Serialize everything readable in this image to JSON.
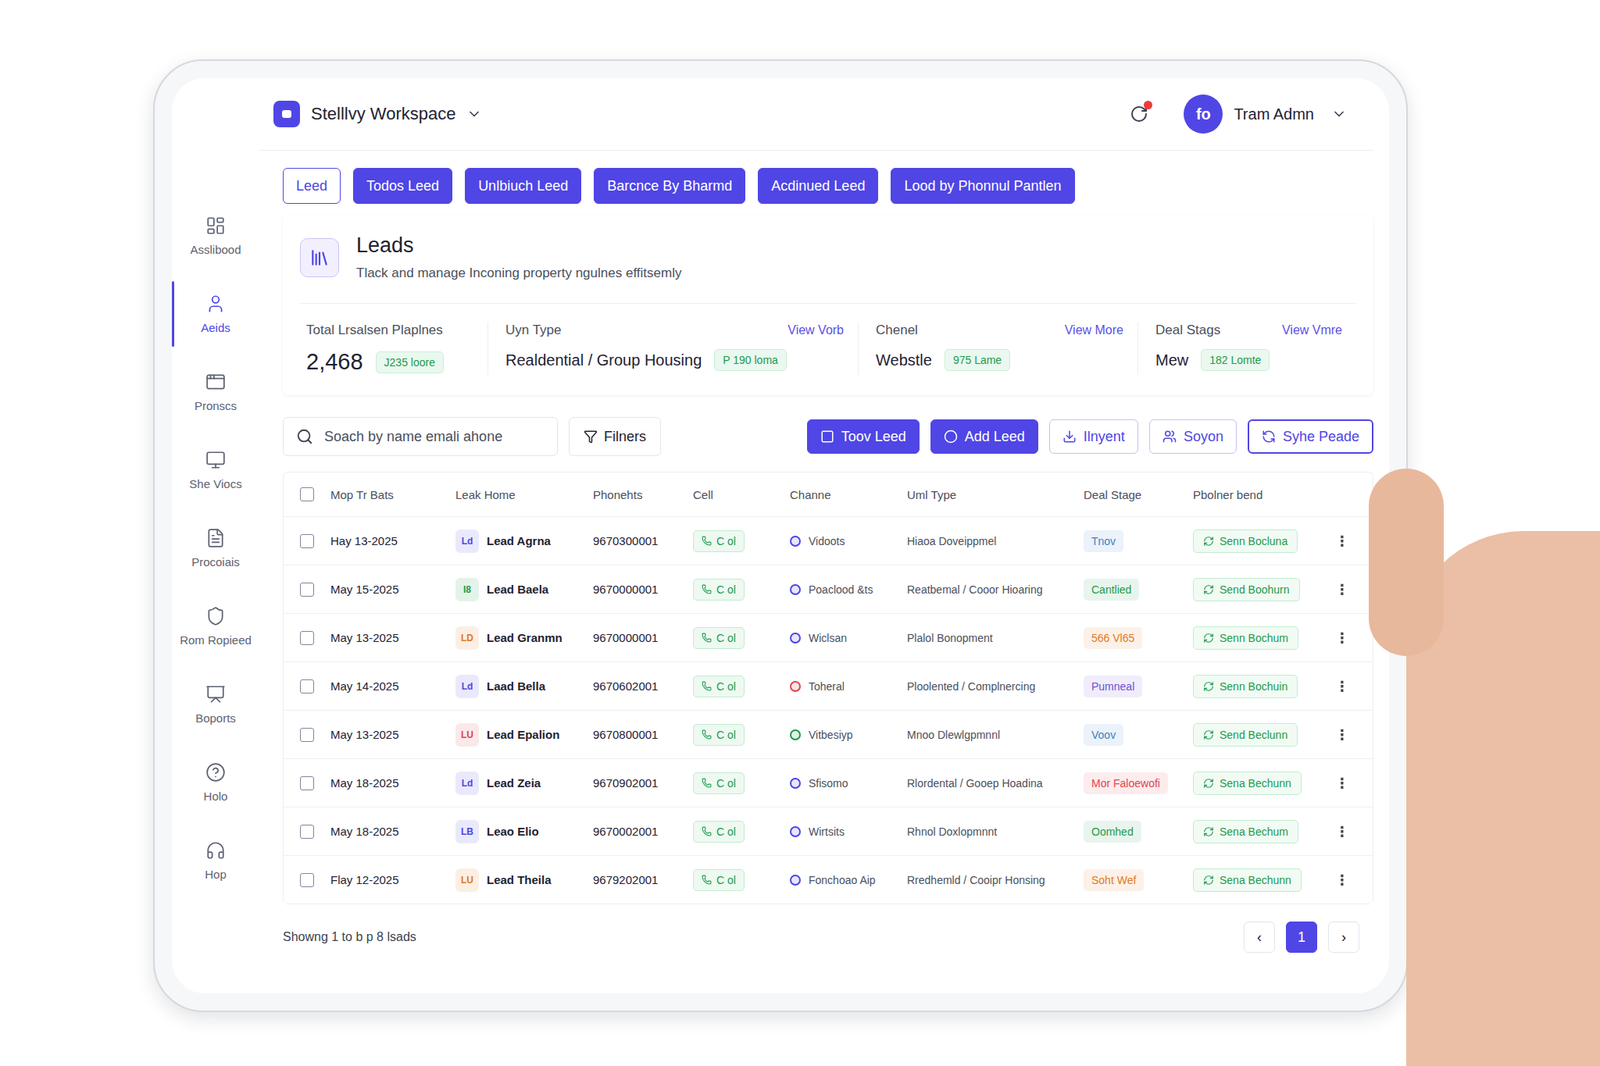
{
  "workspace": {
    "name": "Stelllvy Workspace"
  },
  "user": {
    "initials": "fo",
    "name": "Tram Admn",
    "has_notification": true
  },
  "tabs": [
    {
      "label": "Leed",
      "selected": true
    },
    {
      "label": "Todos Leed",
      "selected": false
    },
    {
      "label": "Unlbiuch Leed",
      "selected": false
    },
    {
      "label": "Barcnce By Bharmd",
      "selected": false
    },
    {
      "label": "Acdinued Leed",
      "selected": false
    },
    {
      "label": "Lood by Phonnul Pantlen",
      "selected": false
    }
  ],
  "sidebar": {
    "items": [
      {
        "label": "Asslibood",
        "selected": false
      },
      {
        "label": "Aeids",
        "selected": true
      },
      {
        "label": "Pronscs",
        "selected": false
      },
      {
        "label": "She Viocs",
        "selected": false
      },
      {
        "label": "Procoiais",
        "selected": false
      },
      {
        "label": "Rom Ropieed",
        "selected": false
      },
      {
        "label": "Boports",
        "selected": false
      },
      {
        "label": "Holo",
        "selected": false
      },
      {
        "label": "Hop",
        "selected": false
      }
    ]
  },
  "page": {
    "title": "Leads",
    "subtitle": "Tlack and manage Inconing property ngulnes effitsemly"
  },
  "stats": [
    {
      "label": "Total Lrsalsen Plaplnes",
      "link": "",
      "value": "2,468",
      "badge": "J235 loore"
    },
    {
      "label": "Uyn Type",
      "link": "View Vorb",
      "value": "Realdential / Group Housing",
      "badge": "P 190 loma"
    },
    {
      "label": "Chenel",
      "link": "View More",
      "value": "Webstle",
      "badge": "975 Lame"
    },
    {
      "label": "Deal Stags",
      "link": "View Vmre",
      "value": "Mew",
      "badge": "182 Lomte"
    }
  ],
  "toolbar": {
    "search_placeholder": "Soach by name emali ahone",
    "filters": "Filners",
    "buttons": [
      {
        "label": "Toov Leed",
        "kind": "primary"
      },
      {
        "label": "Add Leed",
        "kind": "primary"
      },
      {
        "label": "Ilnyent",
        "kind": "outline"
      },
      {
        "label": "Soyon",
        "kind": "outline"
      },
      {
        "label": "Syhe Peade",
        "kind": "strong"
      }
    ]
  },
  "table": {
    "all_selected": false,
    "columns": [
      "Mop Tr Bats",
      "Leak Home",
      "Phonehts",
      "Cell",
      "Channe",
      "Uml Type",
      "Deal Stage",
      "Pbolner bend"
    ],
    "rows": [
      {
        "selected": false,
        "date": "Hay 13-2025",
        "badge": "Ld",
        "badge_color": "#4f46e5",
        "name": "Lead Agrna",
        "phone": "9670300001",
        "cell": "C ol",
        "channel": "Vidoots",
        "channel_color": "#4f46e5",
        "unit_type": "Hiaoa Doveippmel",
        "stage": "Tnov",
        "stage_color": "#3b82c4",
        "action": "Senn Bocluna",
        "menu": "⋮"
      },
      {
        "selected": false,
        "date": "May 15-2025",
        "badge": "I8",
        "badge_color": "#1d9a4c",
        "name": "Lead Baela",
        "phone": "9670000001",
        "cell": "C ol",
        "channel": "Poaclood &ts",
        "channel_color": "#4f46e5",
        "unit_type": "Reatbemal / Cooor Hioaring",
        "stage": "Cantlied",
        "stage_color": "#1d9a4c",
        "action": "Send Boohurn",
        "menu": "⋮"
      },
      {
        "selected": false,
        "date": "May 13-2025",
        "badge": "LD",
        "badge_color": "#e07a1f",
        "name": "Lead Granmn",
        "phone": "9670000001",
        "cell": "C ol",
        "channel": "Wiclsan",
        "channel_color": "#4f46e5",
        "unit_type": "Plalol Bonopment",
        "stage": "566 Vl65",
        "stage_color": "#e07a1f",
        "action": "Senn Bochum",
        "menu": "⋮"
      },
      {
        "selected": false,
        "date": "May 14-2025",
        "badge": "Ld",
        "badge_color": "#4f46e5",
        "name": "Laad Bella",
        "phone": "9670602001",
        "cell": "C ol",
        "channel": "Toheral",
        "channel_color": "#e0454f",
        "unit_type": "Ploolented / Complnercing",
        "stage": "Pumneal",
        "stage_color": "#6d4fd6",
        "action": "Senn Bochuin",
        "menu": "⋮"
      },
      {
        "selected": false,
        "date": "May 13-2025",
        "badge": "LU",
        "badge_color": "#e0454f",
        "name": "Lead Epalion",
        "phone": "9670800001",
        "cell": "C ol",
        "channel": "Vitbesiyp",
        "channel_color": "#1d9a4c",
        "unit_type": "Mnoo Dlewlgpmnnl",
        "stage": "Voov",
        "stage_color": "#3b82c4",
        "action": "Send Beclunn",
        "menu": "⋮"
      },
      {
        "selected": false,
        "date": "May 18-2025",
        "badge": "Ld",
        "badge_color": "#4f46e5",
        "name": "Lead Zeia",
        "phone": "9670902001",
        "cell": "C ol",
        "channel": "Sfisomo",
        "channel_color": "#4f46e5",
        "unit_type": "Rlordental / Gooep Hoadina",
        "stage": "Mor Faloewofi",
        "stage_color": "#e0454f",
        "action": "Sena Bechunn",
        "menu": "⋮"
      },
      {
        "selected": false,
        "date": "May 18-2025",
        "badge": "LB",
        "badge_color": "#4f46e5",
        "name": "Leao Elio",
        "phone": "9670002001",
        "cell": "C ol",
        "channel": "Wirtsits",
        "channel_color": "#4f46e5",
        "unit_type": "Rhnol Doxlopmnnt",
        "stage": "Oomhed",
        "stage_color": "#1d9a4c",
        "action": "Sena Bechum",
        "menu": "⋮"
      },
      {
        "selected": false,
        "date": "Flay 12-2025",
        "badge": "LU",
        "badge_color": "#e07a1f",
        "name": "Lead Theila",
        "phone": "9679202001",
        "cell": "C ol",
        "channel": "Fonchoao Aip",
        "channel_color": "#4f46e5",
        "unit_type": "Rredhemld / Cooipr Honsing",
        "stage": "Soht Wef",
        "stage_color": "#e07a1f",
        "action": "Sena Bechunn",
        "menu": "⋮"
      }
    ]
  },
  "footer": {
    "summary": "Showng 1 to b p 8 lsads",
    "pages": [
      {
        "label": "‹",
        "selected": false
      },
      {
        "label": "1",
        "selected": true
      },
      {
        "label": "›",
        "selected": false
      }
    ]
  }
}
